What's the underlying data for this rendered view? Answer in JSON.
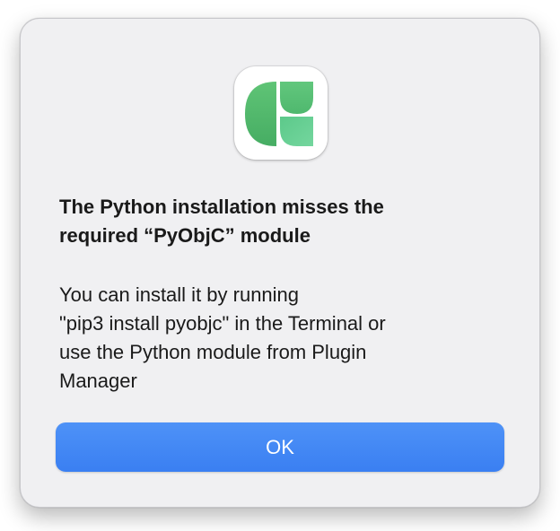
{
  "dialog": {
    "icon": "plugin-manager-app-icon",
    "title_lines": [
      "The Python installation misses the",
      "required “PyObjC” module"
    ],
    "message_lines": [
      "You can install it by running",
      "\"pip3 install pyobjc\" in the Terminal or",
      "use the Python module from Plugin",
      "Manager"
    ],
    "ok_label": "OK"
  },
  "colors": {
    "accent_button": "#3d82f4",
    "dialog_background": "#f0f0f2",
    "icon_green_dark": "#4db36a",
    "icon_green_light": "#6fd495"
  }
}
